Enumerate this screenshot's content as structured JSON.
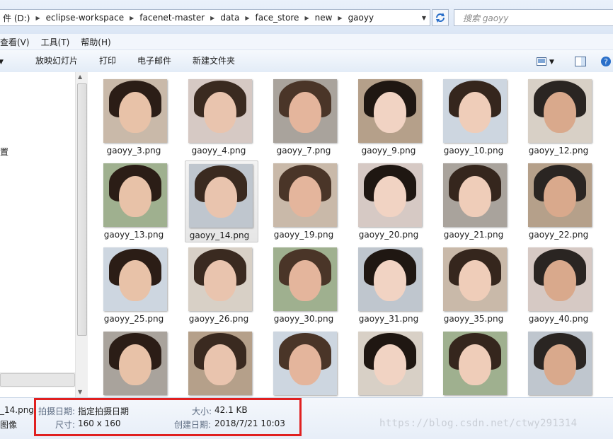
{
  "address": {
    "crumbs": [
      "件 (D:)",
      "eclipse-workspace",
      "facenet-master",
      "data",
      "face_store",
      "new",
      "gaoyy"
    ],
    "search_placeholder": "搜索 gaoyy"
  },
  "menu": [
    "查看(V)",
    "工具(T)",
    "帮助(H)"
  ],
  "commands": [
    "放映幻灯片",
    "打印",
    "电子邮件",
    "新建文件夹"
  ],
  "nav": {
    "partial_item": "置"
  },
  "files": [
    "gaoyy_3.png",
    "gaoyy_4.png",
    "gaoyy_7.png",
    "gaoyy_9.png",
    "gaoyy_10.png",
    "gaoyy_12.png",
    "gaoyy_13.png",
    "gaoyy_14.png",
    "gaoyy_19.png",
    "gaoyy_20.png",
    "gaoyy_21.png",
    "gaoyy_22.png",
    "gaoyy_25.png",
    "gaoyy_26.png",
    "gaoyy_30.png",
    "gaoyy_31.png",
    "gaoyy_35.png",
    "gaoyy_40.png",
    "",
    "",
    "",
    "",
    "",
    ""
  ],
  "selected_file": "gaoyy_14.png",
  "details": {
    "file_name": "_14.png",
    "file_type": "图像",
    "date_taken_label": "拍摄日期:",
    "date_taken_value": "指定拍摄日期",
    "dimensions_label": "尺寸:",
    "dimensions_value": "160 x 160",
    "size_label": "大小:",
    "size_value": "42.1 KB",
    "created_label": "创建日期:",
    "created_value": "2018/7/21 10:03"
  },
  "watermark": "https://blog.csdn.net/ctwy291314",
  "colors": {
    "highlight": "#e02020",
    "toolbar": "#e3ecf7"
  }
}
